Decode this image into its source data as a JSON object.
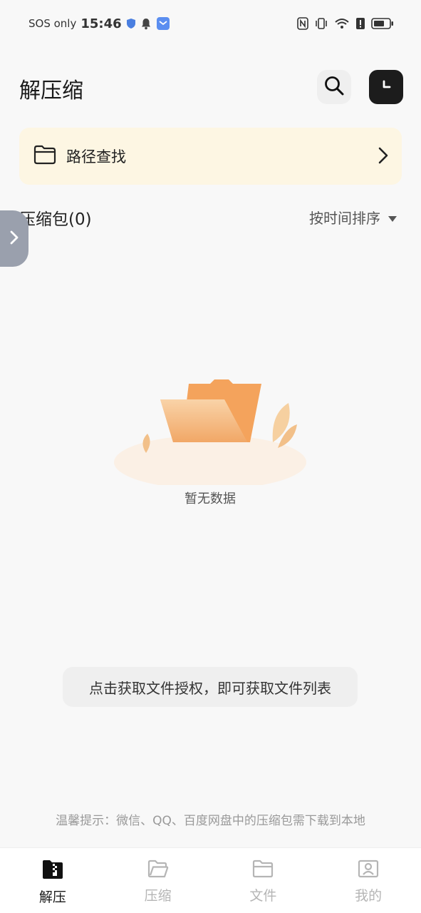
{
  "status_bar": {
    "carrier": "SOS only",
    "time": "15:46",
    "icons": [
      "shield-icon",
      "bell-icon",
      "message-app-icon",
      "nfc-icon",
      "vibrate-icon",
      "wifi-icon",
      "alert-icon",
      "battery-icon"
    ]
  },
  "header": {
    "title": "解压缩",
    "search_icon": "search-icon",
    "history_icon": "clock-icon"
  },
  "path_card": {
    "label": "路径查找",
    "icon": "folder-icon",
    "accent": "#fdf6e3"
  },
  "section": {
    "title": "压缩包(0)",
    "sort_label": "按时间排序"
  },
  "empty_state": {
    "text": "暂无数据"
  },
  "permission_hint": {
    "text": "点击获取文件授权，即可获取文件列表"
  },
  "footer_tip": {
    "text": "温馨提示：微信、QQ、百度网盘中的压缩包需下载到本地"
  },
  "tabbar": {
    "items": [
      {
        "label": "解压",
        "icon": "zip-archive-icon",
        "active": true
      },
      {
        "label": "压缩",
        "icon": "folder-open-icon",
        "active": false
      },
      {
        "label": "文件",
        "icon": "folder-icon",
        "active": false
      },
      {
        "label": "我的",
        "icon": "profile-icon",
        "active": false
      }
    ]
  },
  "colors": {
    "background": "#f8f8f8",
    "card_yellow": "#fdf6e3",
    "dark_button": "#1c1c1c",
    "folder_orange": "#f4a35c",
    "side_tab": "#9aa0ad"
  }
}
